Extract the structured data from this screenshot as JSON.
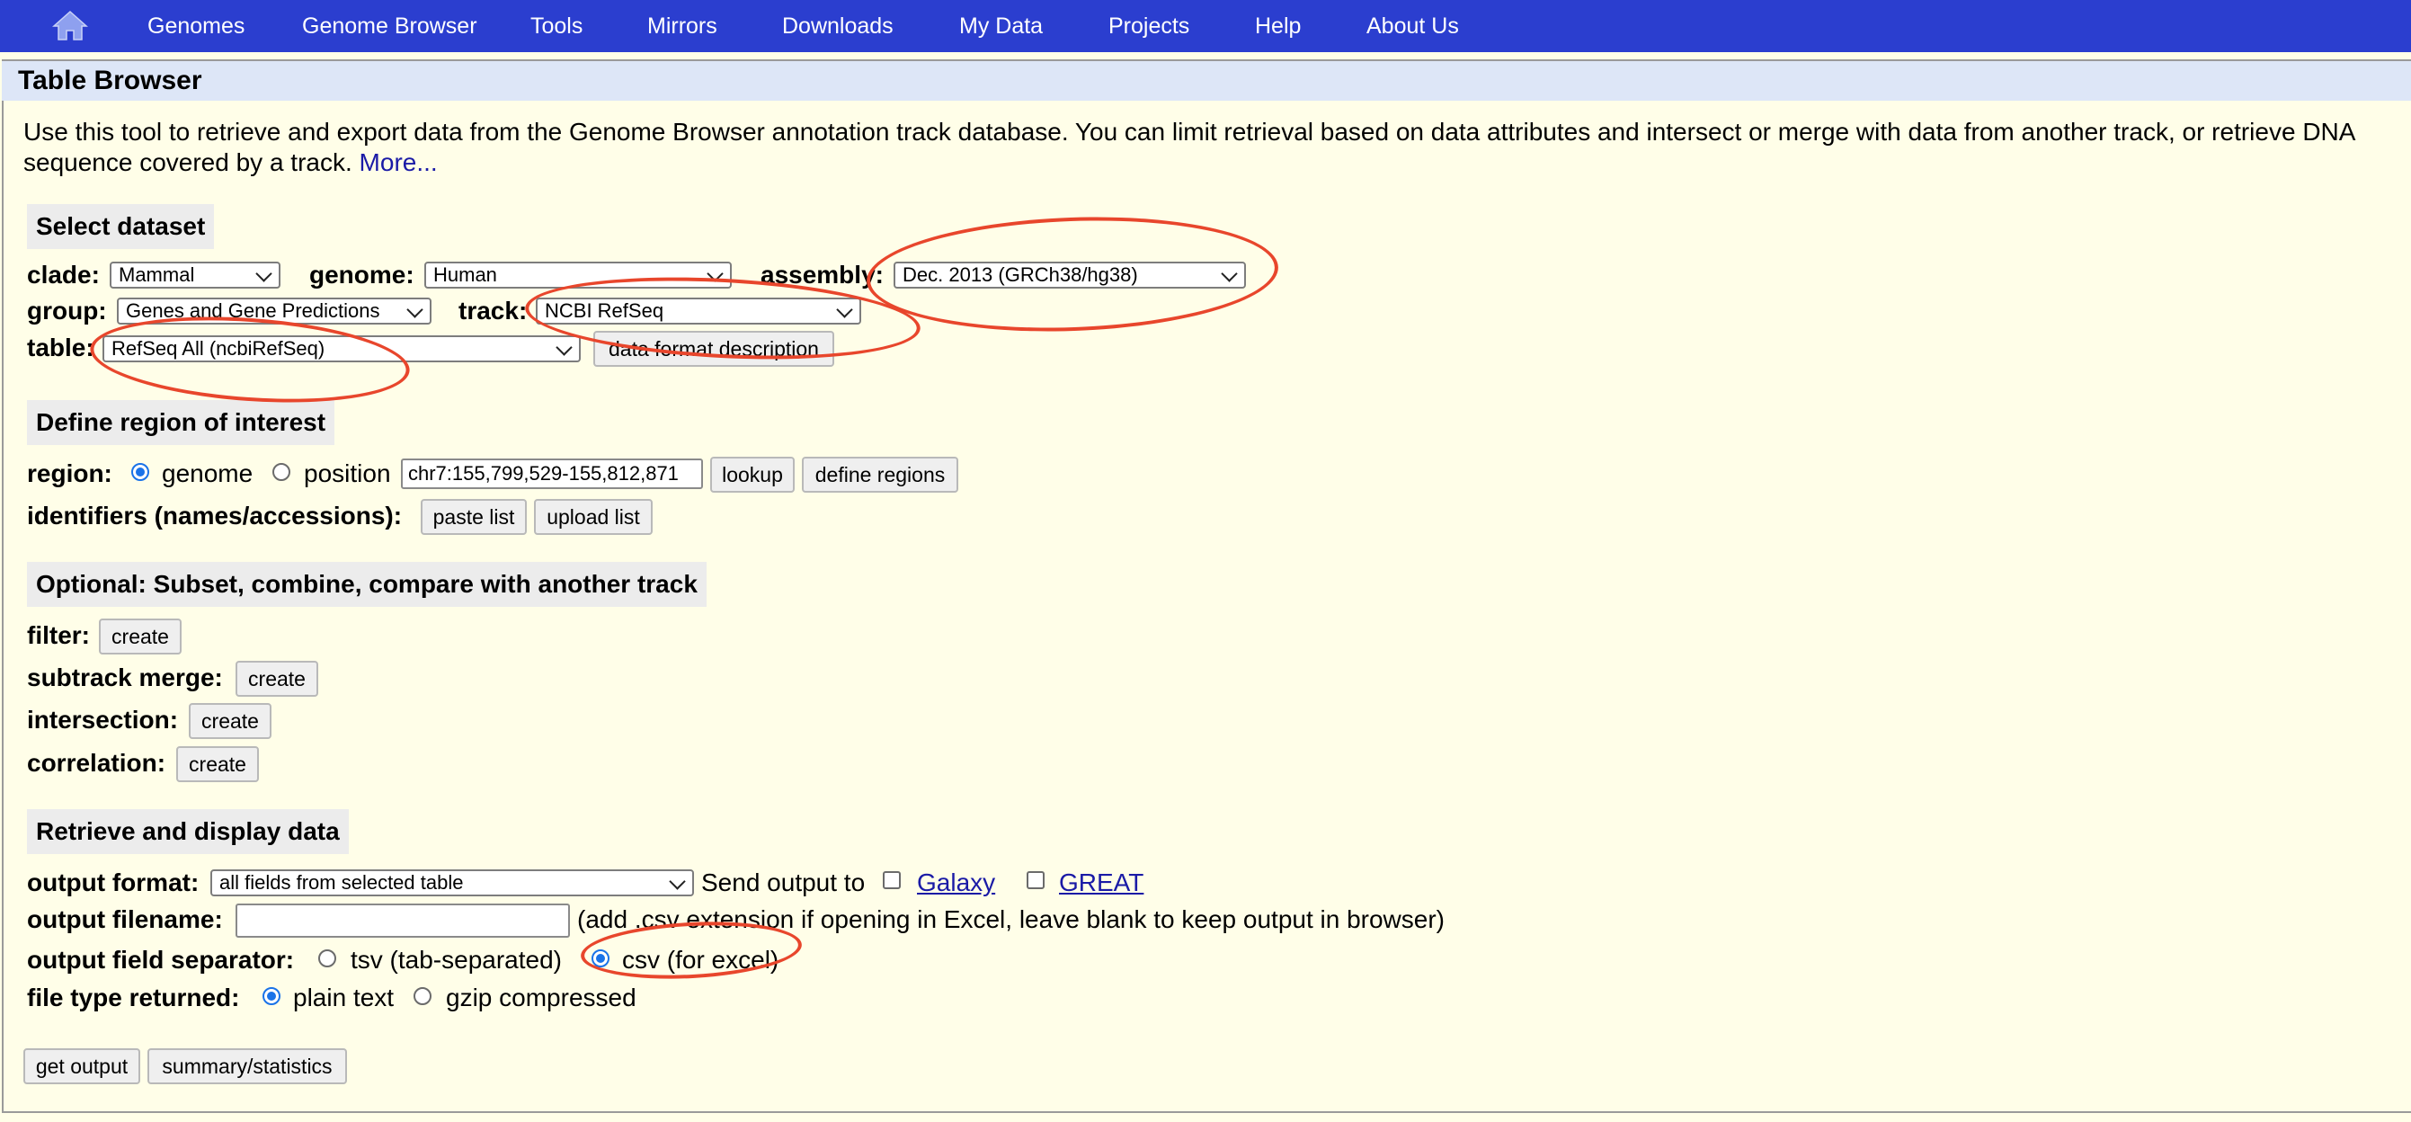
{
  "nav": {
    "home_icon": "home-icon",
    "items": [
      "Genomes",
      "Genome Browser",
      "Tools",
      "Mirrors",
      "Downloads",
      "My Data",
      "Projects",
      "Help",
      "About Us"
    ]
  },
  "page": {
    "title": "Table Browser",
    "intro": "Use this tool to retrieve and export data from the Genome Browser annotation track database. You can limit retrieval based on data attributes and intersect or merge with data from another track, or retrieve DNA sequence covered by a track.",
    "more_link": "More..."
  },
  "dataset": {
    "heading": "Select dataset",
    "clade_label": "clade:",
    "clade_value": "Mammal",
    "genome_label": "genome:",
    "genome_value": "Human",
    "assembly_label": "assembly:",
    "assembly_value": "Dec. 2013 (GRCh38/hg38)",
    "group_label": "group:",
    "group_value": "Genes and Gene Predictions",
    "track_label": "track:",
    "track_value": "NCBI RefSeq",
    "table_label": "table:",
    "table_value": "RefSeq All (ncbiRefSeq)",
    "data_format_button": "data format description"
  },
  "region": {
    "heading": "Define region of interest",
    "region_label": "region:",
    "genome_option": "genome",
    "position_option": "position",
    "position_value": "chr7:155,799,529-155,812,871",
    "selected": "genome",
    "lookup_button": "lookup",
    "define_regions_button": "define regions",
    "identifiers_label": "identifiers (names/accessions):",
    "paste_list_button": "paste list",
    "upload_list_button": "upload list"
  },
  "optional": {
    "heading": "Optional: Subset, combine, compare with another track",
    "filter_label": "filter:",
    "subtrack_label": "subtrack merge:",
    "intersection_label": "intersection:",
    "correlation_label": "correlation:",
    "create_button": "create"
  },
  "retrieve": {
    "heading": "Retrieve and display data",
    "output_format_label": "output format:",
    "output_format_value": "all fields from selected table",
    "send_output_label": "Send output to",
    "galaxy_link": "Galaxy",
    "great_link": "GREAT",
    "output_filename_label": "output filename:",
    "output_filename_value": "",
    "filename_hint": "(add .csv extension if opening in Excel, leave blank to keep output in browser)",
    "separator_label": "output field separator:",
    "tsv_option": "tsv (tab-separated)",
    "csv_option": "csv (for excel)",
    "separator_selected": "csv",
    "file_type_label": "file type returned:",
    "plain_text_option": "plain text",
    "gzip_option": "gzip compressed",
    "file_type_selected": "plain text",
    "get_output_button": "get output",
    "summary_button": "summary/statistics"
  },
  "colors": {
    "nav_bg": "#2b3ecf",
    "page_bg": "#fffee8",
    "title_bar_bg": "#dde6f7",
    "annotation_red": "#e8462c",
    "link": "#1a1aa6"
  }
}
